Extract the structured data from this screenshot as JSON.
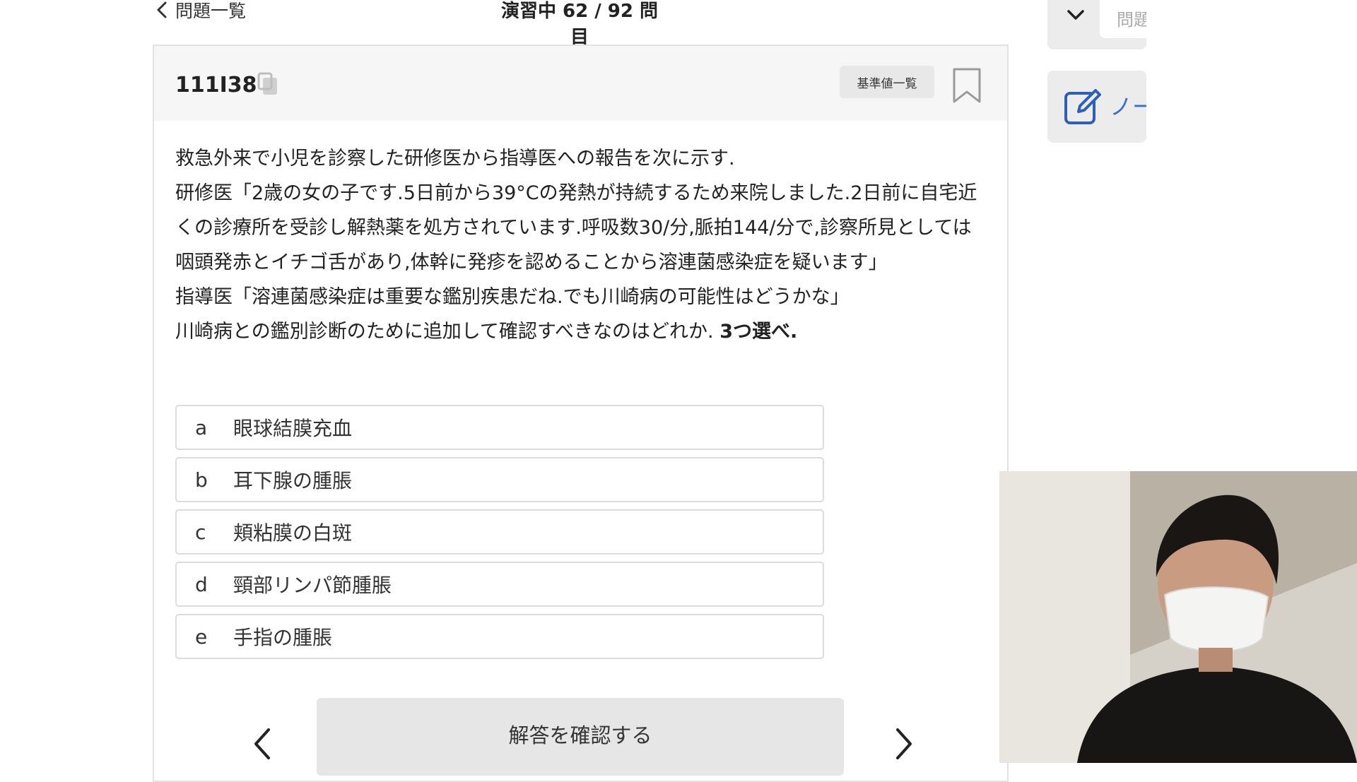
{
  "header": {
    "back_label": "問題一覧",
    "progress_label": "演習中 62 / 92 問目"
  },
  "question": {
    "id": "111I38",
    "reference_button": "基準値一覧",
    "lines": [
      "救急外来で小児を診察した研修医から指導医への報告を次に示す.",
      "研修医「2歳の女の子です.5日前から39°Cの発熱が持続するため来院しました.2日前に自宅近くの診療所を受診し解熱薬を処方されています.呼吸数30/分,脈拍144/分で,診察所見としては咽頭発赤とイチゴ舌があり,体幹に発疹を認めることから溶連菌感染症を疑います」",
      "指導医「溶連菌感染症は重要な鑑別疾患だね.でも川崎病の可能性はどうかな」"
    ],
    "prompt": "川崎病との鑑別診断のために追加して確認すべきなのはどれか.",
    "prompt_emphasis": "3つ選べ.",
    "choices": [
      {
        "letter": "a",
        "text": "眼球結膜充血"
      },
      {
        "letter": "b",
        "text": "耳下腺の腫脹"
      },
      {
        "letter": "c",
        "text": "頬粘膜の白斑"
      },
      {
        "letter": "d",
        "text": "頸部リンパ節腫脹"
      },
      {
        "letter": "e",
        "text": "手指の腫脹"
      }
    ],
    "confirm_button": "解答を確認する"
  },
  "side": {
    "input_placeholder": "問題",
    "note_label": "ノー"
  },
  "colors": {
    "accent_blue": "#3b6fcc",
    "panel_gray": "#ececec",
    "border_gray": "#dcdcdc"
  },
  "icons": [
    "chevron-left-icon",
    "copy-icon",
    "bookmark-icon",
    "chevron-right-icon",
    "chevron-down-icon",
    "edit-note-icon"
  ]
}
